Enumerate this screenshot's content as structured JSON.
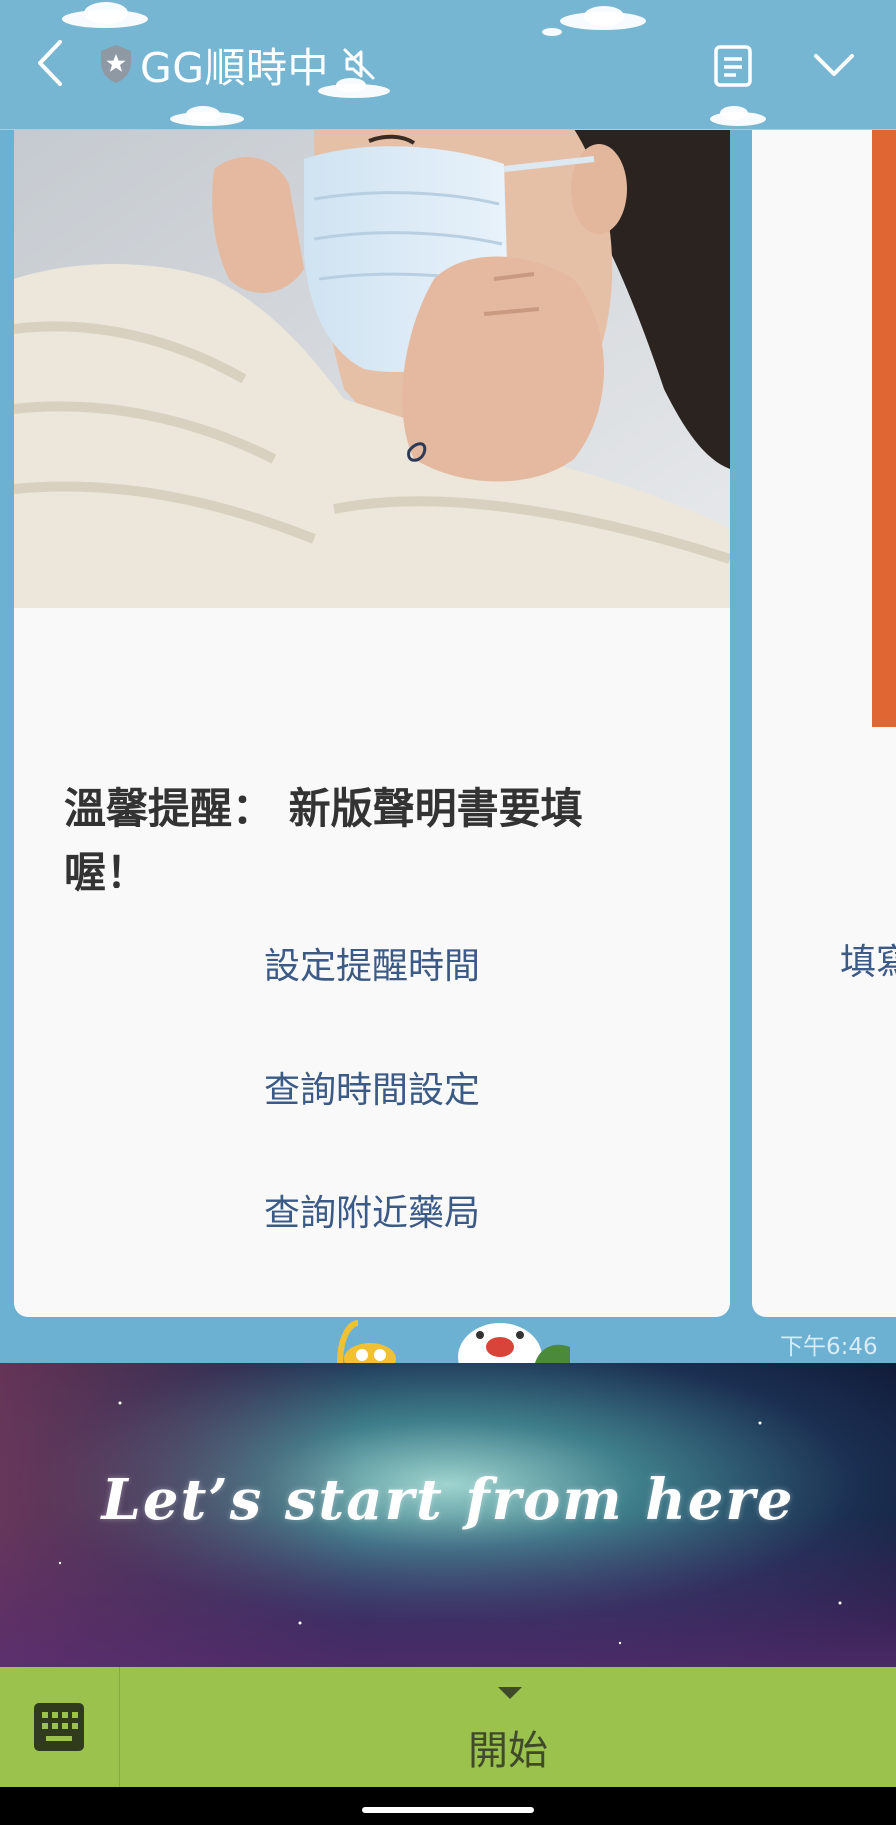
{
  "header": {
    "chat_title": "GG順時中",
    "icons": [
      "chevron-left-icon",
      "shield-star-icon",
      "mute-icon",
      "notes-icon",
      "chevron-down-icon"
    ]
  },
  "card": {
    "image_alt": "person putting on a face mask",
    "title": "溫馨提醒： 新版聲明書要填喔！",
    "actions": [
      {
        "label": "設定提醒時間"
      },
      {
        "label": "查詢時間設定"
      },
      {
        "label": "查詢附近藥局"
      }
    ]
  },
  "card_2": {
    "action_partial": "填寫"
  },
  "message": {
    "time": "下午6:46"
  },
  "rich_menu": {
    "text": "Let’s start from here"
  },
  "bottom_bar": {
    "menu_label": "開始",
    "icons": [
      "keyboard-icon",
      "caret-down-icon"
    ]
  },
  "colors": {
    "chat_background": "#6cb1d1",
    "header_background": "#76b6d3",
    "action_text": "#3b5a86",
    "bottom_bar": "#9bc24d",
    "card_2_image": "#e06634"
  }
}
